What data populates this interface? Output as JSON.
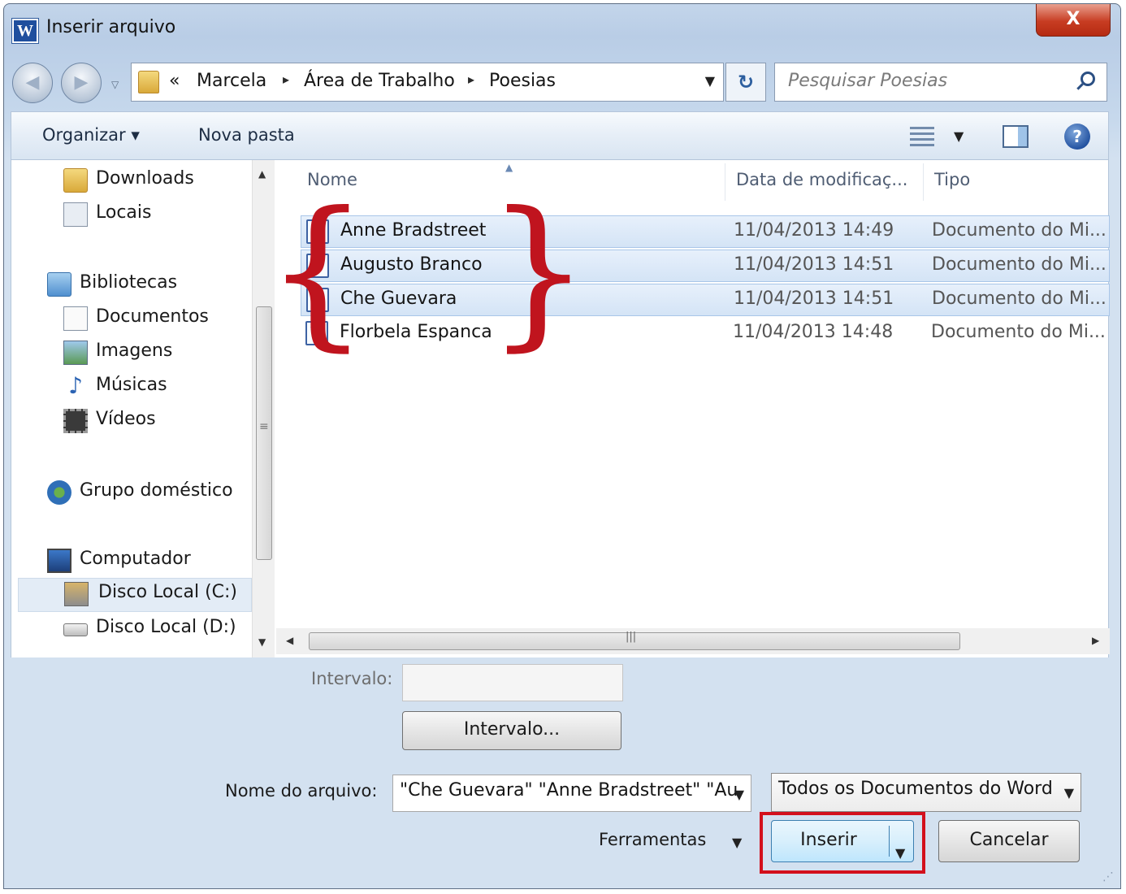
{
  "window": {
    "title": "Inserir arquivo",
    "close_glyph": "X",
    "app_icon_letter": "W"
  },
  "address": {
    "crumb_prefix": "«",
    "crumbs": [
      "Marcela",
      "Área de Trabalho",
      "Poesias"
    ],
    "separator": "▸",
    "dropdown_glyph": "▼",
    "refresh_glyph": "↻"
  },
  "search": {
    "placeholder": "Pesquisar Poesias"
  },
  "toolbar": {
    "organize_label": "Organizar ▾",
    "new_folder_label": "Nova pasta",
    "view_dd_glyph": "▼",
    "help_glyph": "?"
  },
  "nav": {
    "items": [
      {
        "label": "Downloads",
        "icon": "downloads-folder-icon"
      },
      {
        "label": "Locais",
        "icon": "places-icon"
      },
      {
        "label": "Bibliotecas",
        "icon": "libraries-icon"
      },
      {
        "label": "Documentos",
        "icon": "documents-icon"
      },
      {
        "label": "Imagens",
        "icon": "pictures-icon"
      },
      {
        "label": "Músicas",
        "icon": "music-icon"
      },
      {
        "label": "Vídeos",
        "icon": "videos-icon"
      },
      {
        "label": "Grupo doméstico",
        "icon": "homegroup-icon"
      },
      {
        "label": "Computador",
        "icon": "computer-icon"
      },
      {
        "label": "Disco Local (C:)",
        "icon": "drive-c-icon",
        "selected": true
      },
      {
        "label": "Disco Local (D:)",
        "icon": "drive-d-icon"
      }
    ]
  },
  "files": {
    "columns": [
      "Nome",
      "Data de modificaç...",
      "Tipo"
    ],
    "rows": [
      {
        "name": "Anne Bradstreet",
        "date": "11/04/2013 14:49",
        "type": "Documento do Mi...",
        "selected": true
      },
      {
        "name": "Augusto Branco",
        "date": "11/04/2013 14:51",
        "type": "Documento do Mi...",
        "selected": true
      },
      {
        "name": "Che Guevara",
        "date": "11/04/2013 14:51",
        "type": "Documento do Mi...",
        "selected": true
      },
      {
        "name": "Florbela Espanca",
        "date": "11/04/2013 14:48",
        "type": "Documento do Mi...",
        "selected": false
      }
    ]
  },
  "range": {
    "label": "Intervalo:",
    "value": "",
    "button_label": "Intervalo..."
  },
  "filename": {
    "label": "Nome do arquivo:",
    "value": "\"Che Guevara\" \"Anne Bradstreet\" \"Au",
    "dropdown_glyph": "▼"
  },
  "filetype": {
    "value": "Todos os Documentos do Word",
    "dropdown_glyph": "▼"
  },
  "actions": {
    "tools_label": "Ferramentas",
    "tools_dd_glyph": "▼",
    "insert_label": "Inserir",
    "insert_dd_glyph": "▼",
    "cancel_label": "Cancelar"
  },
  "colors": {
    "annotation_red": "#d3101c",
    "selection_blue": "#d4e4f6"
  }
}
